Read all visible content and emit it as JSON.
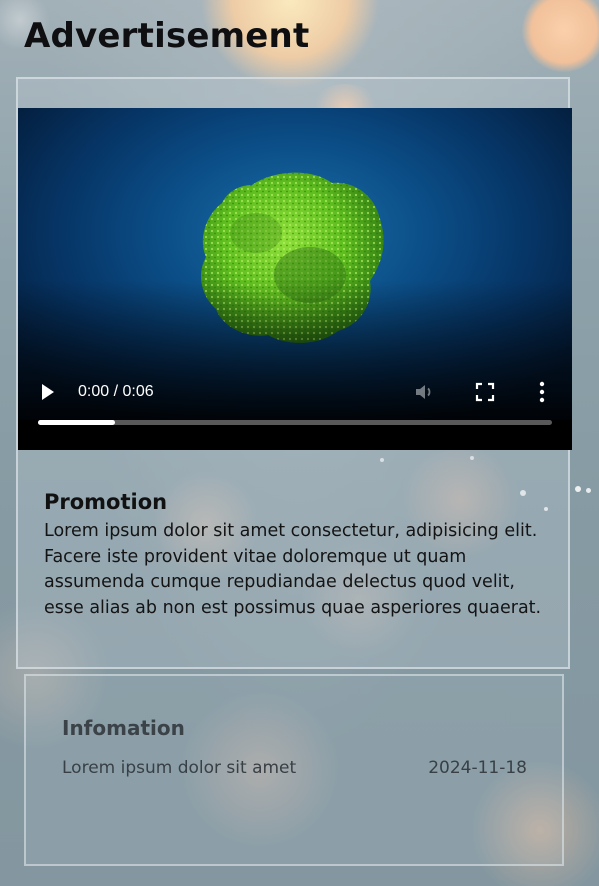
{
  "page": {
    "title": "Advertisement"
  },
  "ad": {
    "video": {
      "current_time": "0:00",
      "duration": "0:06",
      "time_display": "0:00 / 0:06",
      "progress_fraction": 0.15,
      "icons": {
        "play": "play-icon",
        "mute": "volume-icon",
        "fullscreen": "fullscreen-icon",
        "more": "more-vertical-icon"
      }
    },
    "heading": "Promotion",
    "body": "Lorem ipsum dolor sit amet consectetur, adipisicing elit. Facere iste provident vitae doloremque ut quam assumenda cumque repudiandae delectus quod velit, esse alias ab non est possimus quae asperiores quaerat."
  },
  "info": {
    "title": "Infomation",
    "item_text": "Lorem ipsum dolor sit amet",
    "item_date": "2024-11-18"
  },
  "colors": {
    "background": "#8a9ea7",
    "video_blue": "#0b4d86",
    "moss_green": "#6fcf2a",
    "bokeh_peach": "#ffd7a8"
  }
}
